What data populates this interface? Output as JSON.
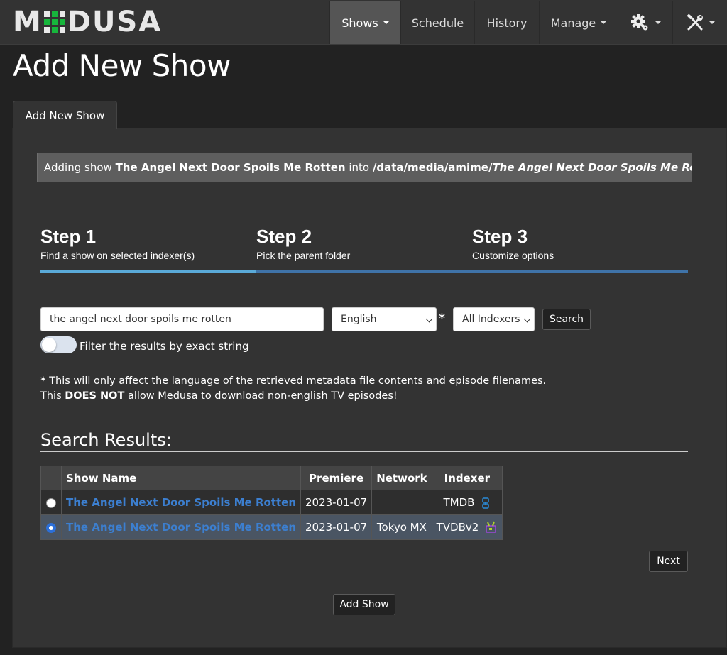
{
  "nav": {
    "logo": "MEDUSA",
    "items": [
      {
        "label": "Shows",
        "has_caret": true,
        "active": true
      },
      {
        "label": "Schedule"
      },
      {
        "label": "History"
      },
      {
        "label": "Manage",
        "has_caret": true
      }
    ],
    "icons": [
      "gear-icon",
      "tools-icon"
    ]
  },
  "page": {
    "title": "Add New Show",
    "tab": "Add New Show"
  },
  "adding": {
    "prefix": "Adding show",
    "show": "The Angel Next Door Spoils Me Rotten",
    "mid": "into",
    "path": "/data/media/amime/",
    "path_show": "The Angel Next Door Spoils Me Rotten/"
  },
  "steps": [
    {
      "num": "Step 1",
      "desc": "Find a show on selected indexer(s)"
    },
    {
      "num": "Step 2",
      "desc": "Pick the parent folder"
    },
    {
      "num": "Step 3",
      "desc": "Customize options"
    }
  ],
  "search": {
    "query": "the angel next door spoils me rotten",
    "language": "English",
    "asterisk": "*",
    "indexer": "All Indexers",
    "button": "Search",
    "exact_filter_label": "Filter the results by exact string",
    "exact_filter_on": false
  },
  "notes": {
    "line1_star": "*",
    "line1": "This will only affect the language of the retrieved metadata file contents and episode filenames.",
    "line2_pre": "This",
    "line2_bold": "DOES NOT",
    "line2_post": "allow Medusa to download non-english TV episodes!"
  },
  "results": {
    "title": "Search Results:",
    "headers": [
      "Show Name",
      "Premiere",
      "Network",
      "Indexer"
    ],
    "rows": [
      {
        "name": "The Angel Next Door Spoils Me Rotten",
        "premiere": "2023-01-07",
        "network": "",
        "indexer": "TMDB",
        "selected": false
      },
      {
        "name": "The Angel Next Door Spoils Me Rotten",
        "premiere": "2023-01-07",
        "network": "Tokyo MX",
        "indexer": "TVDBv2",
        "selected": true
      }
    ]
  },
  "buttons": {
    "next": "Next",
    "add_show": "Add Show"
  },
  "colors": {
    "accent_blue": "#3c7fd0",
    "progress_active": "#5aaad8",
    "progress": "#3f73a8",
    "logo_green": "#17b63c"
  }
}
